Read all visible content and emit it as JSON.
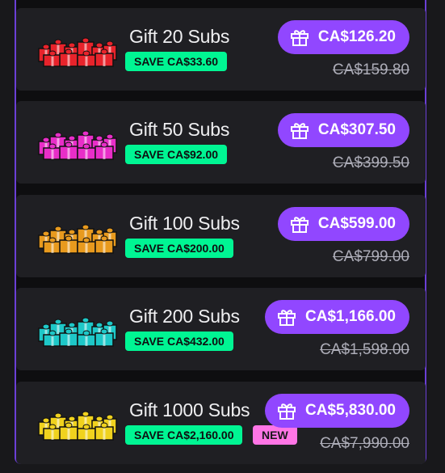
{
  "offers": [
    {
      "title": "Gift 20 Subs",
      "save": "SAVE CA$33.60",
      "price": "CA$126.20",
      "original": "CA$159.80",
      "color": "#e8232b",
      "badge": null
    },
    {
      "title": "Gift 50 Subs",
      "save": "SAVE CA$92.00",
      "price": "CA$307.50",
      "original": "CA$399.50",
      "color": "#e82ec8",
      "badge": null
    },
    {
      "title": "Gift 100 Subs",
      "save": "SAVE CA$200.00",
      "price": "CA$599.00",
      "original": "CA$799.00",
      "color": "#e89a1e",
      "badge": null
    },
    {
      "title": "Gift 200 Subs",
      "save": "SAVE CA$432.00",
      "price": "CA$1,166.00",
      "original": "CA$1,598.00",
      "color": "#1ec8c8",
      "badge": null
    },
    {
      "title": "Gift 1000 Subs",
      "save": "SAVE CA$2,160.00",
      "price": "CA$5,830.00",
      "original": "CA$7,990.00",
      "color": "#f0d21e",
      "badge": "NEW"
    }
  ],
  "icons": {
    "buy": "gift-icon"
  },
  "colors": {
    "accent": "#9147ff",
    "save_badge": "#00f593",
    "new_badge": "#ff75e6",
    "border": "#6b3fd6"
  }
}
